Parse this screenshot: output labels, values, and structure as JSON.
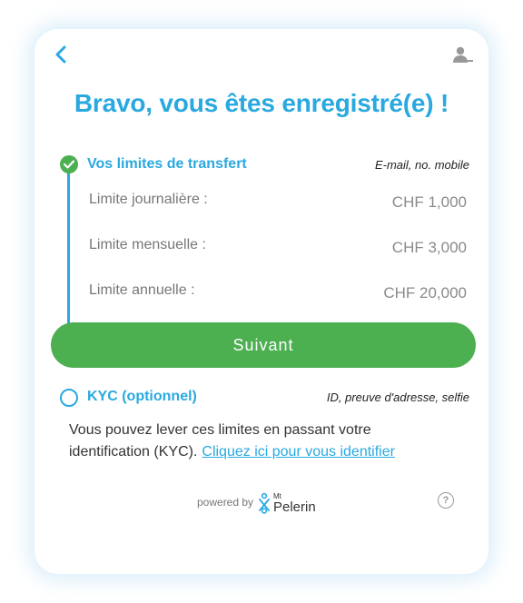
{
  "header": {
    "title": "Bravo, vous êtes enregistré(e) !"
  },
  "transfer_limits": {
    "title": "Vos limites de transfert",
    "hint": "E-mail, no. mobile",
    "rows": [
      {
        "label": "Limite journalière :",
        "value": "CHF 1,000"
      },
      {
        "label": "Limite mensuelle :",
        "value": "CHF 3,000"
      },
      {
        "label": "Limite annuelle :",
        "value": "CHF 20,000"
      }
    ]
  },
  "next_button": {
    "label": "Suivant"
  },
  "kyc": {
    "title": "KYC (optionnel)",
    "hint": "ID, preuve d'adresse, selfie",
    "description": "Vous pouvez lever ces limites en passant votre identification (KYC).",
    "link": "Cliquez ici pour vous identifier"
  },
  "footer": {
    "powered_by": "powered by",
    "brand_small": "Mt",
    "brand_name": "Pelerin",
    "help": "?"
  },
  "colors": {
    "accent": "#29a9e0",
    "success": "#4caf50"
  },
  "icons": [
    "back-arrow-icon",
    "user-logout-icon",
    "check-icon",
    "pelerin-logo-icon",
    "help-icon"
  ]
}
